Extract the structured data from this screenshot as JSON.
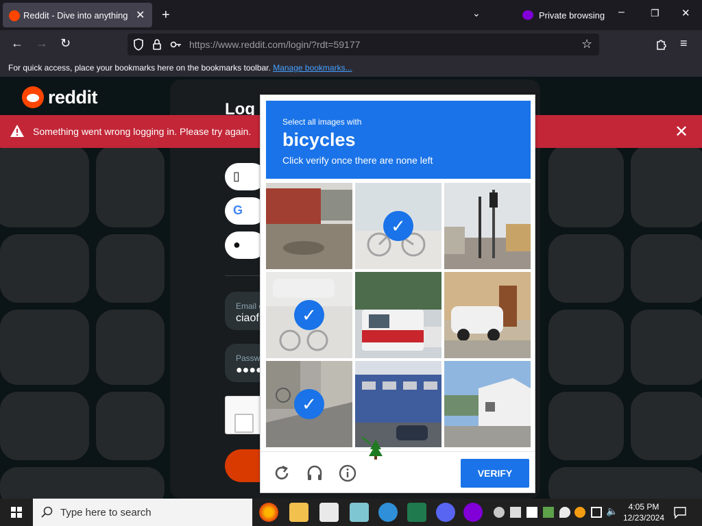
{
  "browser": {
    "tab_title": "Reddit - Dive into anything",
    "private_label": "Private browsing",
    "url": "https://www.reddit.com/login/?rdt=59177",
    "bookmarks_text": "For quick access, place your bookmarks here on the bookmarks toolbar.",
    "bookmarks_link": "Manage bookmarks..."
  },
  "page": {
    "logo_text": "reddit",
    "login_title": "Log",
    "email_label": "Email o",
    "email_value": "ciaof",
    "password_label": "Passwo",
    "password_value": "●●●●",
    "error_message": "Something went wrong logging in. Please try again."
  },
  "captcha": {
    "instruction": "Select all images with",
    "target": "bicycles",
    "hint": "Click verify once there are none left",
    "verify_label": "VERIFY",
    "tiles": [
      {
        "scene": "street with red wall and muddy road",
        "selected": false
      },
      {
        "scene": "bicycle",
        "selected": true
      },
      {
        "scene": "traffic lights and buildings",
        "selected": false
      },
      {
        "scene": "bicycle on street with car",
        "selected": true
      },
      {
        "scene": "red and white bus",
        "selected": false
      },
      {
        "scene": "white car near building",
        "selected": false
      },
      {
        "scene": "street with bicycle",
        "selected": true
      },
      {
        "scene": "blue building with cars",
        "selected": false
      },
      {
        "scene": "white building with hills",
        "selected": false
      }
    ]
  },
  "taskbar": {
    "search_placeholder": "Type here to search",
    "time": "4:05 PM",
    "date": "12/23/2024"
  },
  "colors": {
    "reddit_orange": "#ff4500",
    "captcha_blue": "#1a73e8",
    "error_red": "#c22637"
  }
}
